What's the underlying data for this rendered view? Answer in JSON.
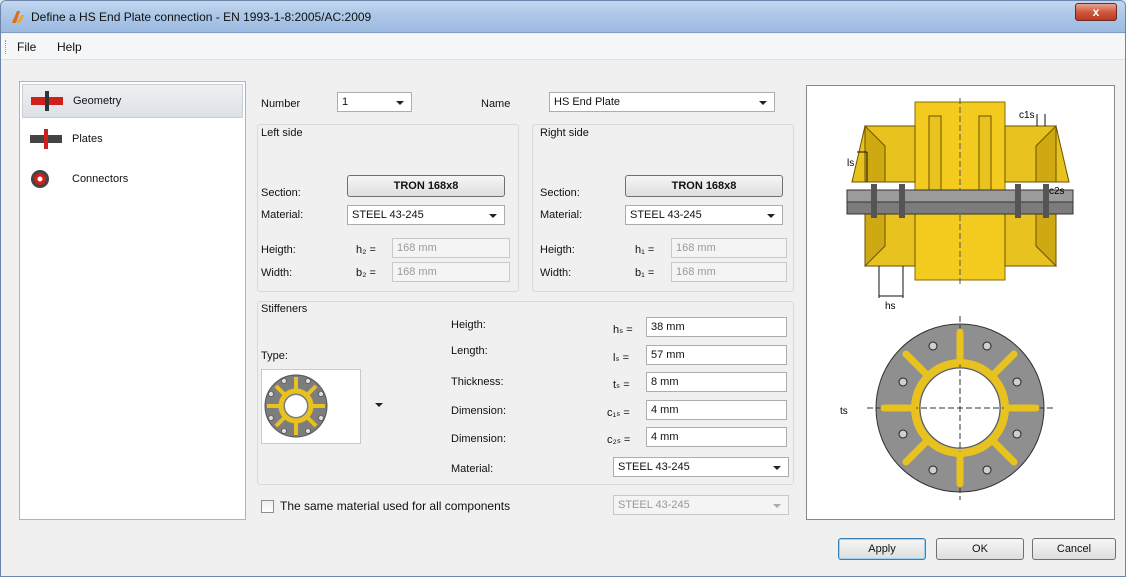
{
  "window": {
    "title": "Define a HS End Plate connection - EN 1993-1-8:2005/AC:2009",
    "close_label": "x"
  },
  "menu": {
    "file": "File",
    "help": "Help"
  },
  "nav": [
    {
      "label": "Geometry",
      "icon": "geometry-icon"
    },
    {
      "label": "Plates",
      "icon": "plates-icon"
    },
    {
      "label": "Connectors",
      "icon": "connectors-icon"
    }
  ],
  "form": {
    "number_label": "Number",
    "number_value": "1",
    "name_label": "Name",
    "name_value": "HS End Plate",
    "left": {
      "title": "Left side",
      "section_label": "Section:",
      "section_value": "TRON 168x8",
      "material_label": "Material:",
      "material_value": "STEEL 43-245",
      "height_label": "Heigth:",
      "height_sym": "h₂ =",
      "height_value": "168 mm",
      "width_label": "Width:",
      "width_sym": "b₂ =",
      "width_value": "168 mm"
    },
    "right": {
      "title": "Right side",
      "section_label": "Section:",
      "section_value": "TRON 168x8",
      "material_label": "Material:",
      "material_value": "STEEL 43-245",
      "height_label": "Heigth:",
      "height_sym": "h₁ =",
      "height_value": "168 mm",
      "width_label": "Width:",
      "width_sym": "b₁ =",
      "width_value": "168 mm"
    },
    "stiffeners": {
      "title": "Stiffeners",
      "type_label": "Type:",
      "height_label": "Heigth:",
      "height_sym": "hₛ =",
      "height_value": "38 mm",
      "length_label": "Length:",
      "length_sym": "lₛ =",
      "length_value": "57 mm",
      "thickness_label": "Thickness:",
      "thickness_sym": "tₛ =",
      "thickness_value": "8 mm",
      "dim1_label": "Dimension:",
      "dim1_sym": "c₁ₛ =",
      "dim1_value": "4 mm",
      "dim2_label": "Dimension:",
      "dim2_sym": "c₂ₛ =",
      "dim2_value": "4 mm",
      "material_label": "Material:",
      "material_value": "STEEL 43-245"
    },
    "same_material_label": "The same material used for all components",
    "same_material_value": "STEEL 43-245"
  },
  "preview": {
    "c1s": "c1s",
    "c2s": "c2s",
    "ls": "ls",
    "hs": "hs",
    "ts": "ts"
  },
  "buttons": {
    "apply": "Apply",
    "ok": "OK",
    "cancel": "Cancel"
  },
  "colors": {
    "accent": "#e8c21e",
    "steel": "#7a7a7a",
    "nav_red": "#d0201b"
  }
}
